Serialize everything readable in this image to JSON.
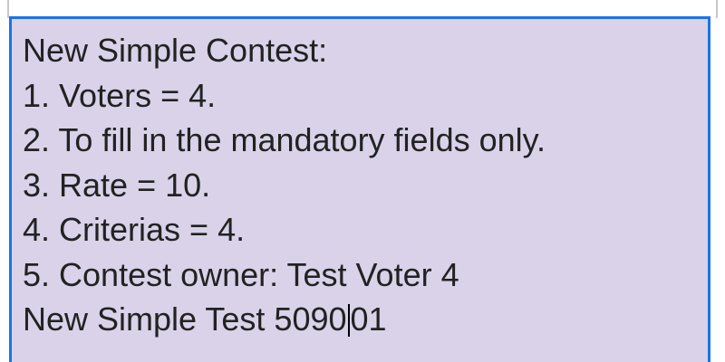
{
  "cell": {
    "lines": [
      "New Simple Contest:",
      "1. Voters = 4.",
      "2. To fill in the mandatory fields only.",
      "3. Rate = 10.",
      "4. Criterias = 4.",
      "5. Contest owner: Test Voter 4"
    ],
    "last_line_before_caret": "New Simple Test 5090",
    "last_line_after_caret": "01"
  },
  "colors": {
    "cell_background": "#d9d2e9",
    "selection_border": "#1a73e8",
    "text": "#222222"
  }
}
